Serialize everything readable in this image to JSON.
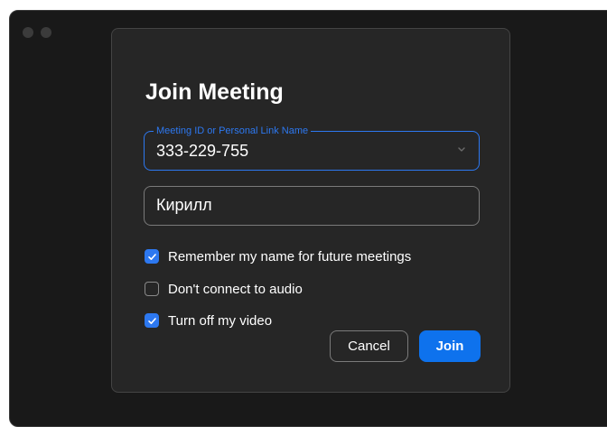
{
  "dialog": {
    "title": "Join Meeting",
    "meeting_field": {
      "label": "Meeting ID or Personal Link Name",
      "value": "333-229-755",
      "icon": "chevron-down-icon"
    },
    "name_field": {
      "value": "Кирилл"
    },
    "options": [
      {
        "label": "Remember my name for future meetings",
        "checked": true
      },
      {
        "label": "Don't connect to audio",
        "checked": false
      },
      {
        "label": "Turn off my video",
        "checked": true
      }
    ],
    "buttons": {
      "cancel": "Cancel",
      "join": "Join"
    }
  },
  "colors": {
    "accent": "#2d78f0",
    "join_button": "#0e72ed",
    "dialog_bg": "#262626",
    "window_bg": "#191919"
  }
}
